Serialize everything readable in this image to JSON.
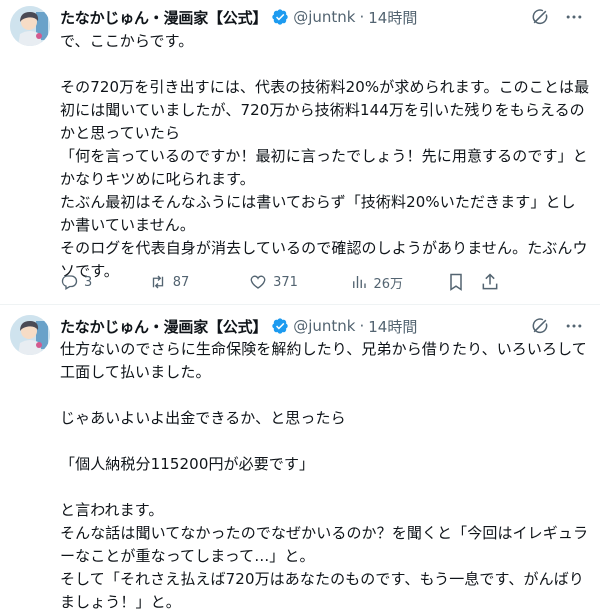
{
  "tweets": [
    {
      "author": {
        "name": "たなかじゅん・漫画家【公式】",
        "handle": "@juntnk",
        "time": "14時間"
      },
      "text": "で、ここからです。\n\nその720万を引き出すには、代表の技術料20%が求められます。このことは最初には聞いていましたが、720万から技術料144万を引いた残りをもらえるのかと思っていたら\n「何を言っているのですか！最初に言ったでしょう！先に用意するのです」とかなりキツめに叱られます。\nたぶん最初はそんなふうには書いておらず「技術料20%いただきます」としか書いていません。\nそのログを代表自身が消去しているので確認のしようがありません。たぶんウソです。",
      "stats": {
        "replies": "3",
        "reposts": "87",
        "likes": "371",
        "views": "26万"
      }
    },
    {
      "author": {
        "name": "たなかじゅん・漫画家【公式】",
        "handle": "@juntnk",
        "time": "14時間"
      },
      "text": "仕方ないのでさらに生命保険を解約したり、兄弟から借りたり、いろいろして工面して払いました。\n\nじゃあいよいよ出金できるか、と思ったら\n\n「個人納税分115200円が必要です」\n\nと言われます。\nそんな話は聞いてなかったのでなぜかいるのか？を聞くと「今回はイレギュラーなことが重なってしまって…」と。\nそして「それさえ払えば720万はあなたのものです、もう一息です、がんばりましょう！」と。"
    }
  ],
  "separator": "·",
  "colors": {
    "verified": "#1d9bf0",
    "muted": "#536471",
    "text": "#0f1419"
  },
  "icons": [
    "verified-badge-icon",
    "grok-icon",
    "more-icon",
    "reply-icon",
    "repost-icon",
    "like-icon",
    "views-icon",
    "bookmark-icon",
    "share-icon"
  ]
}
